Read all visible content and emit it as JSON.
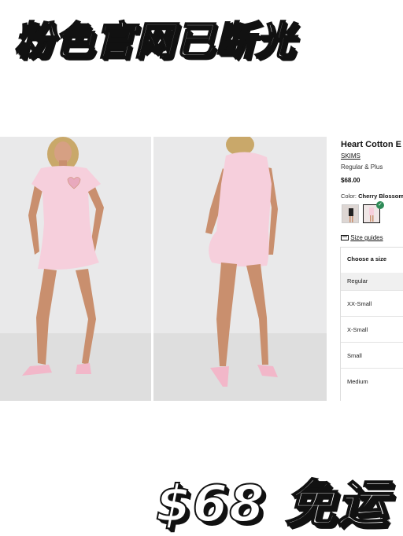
{
  "banner": {
    "title": "粉色官网已断光"
  },
  "bottom_banner": {
    "text": "$68 免运"
  },
  "product": {
    "title": "Heart Cotton E",
    "brand": "SKIMS",
    "fit": "Regular & Plus",
    "price": "$68.00",
    "color_label": "Color:",
    "color_value": "Cherry Blossom",
    "size_guides": "Size guides",
    "choose_size": "Choose a size",
    "size_group": "Regular",
    "sizes": [
      "XX-Small",
      "X-Small",
      "Small",
      "Medium"
    ]
  },
  "colors": {
    "dress": "#f6cfdc",
    "background": "#e9e9ea",
    "skin": "#c98f6e",
    "hair": "#c9a86a",
    "check": "#2e8b57"
  },
  "icons": [
    "ruler-icon",
    "check-icon"
  ]
}
